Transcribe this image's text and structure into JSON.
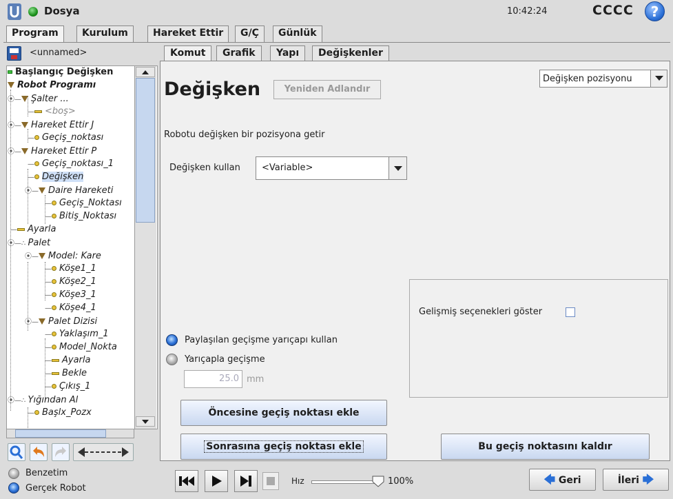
{
  "app": {
    "title": "Dosya",
    "clock": "10:42:24",
    "robot_name": "CCCC",
    "help": "?"
  },
  "main_tabs": [
    {
      "label": "Program"
    },
    {
      "label": "Kurulum"
    },
    {
      "label": "Hareket Ettir"
    },
    {
      "label": "G/Ç"
    },
    {
      "label": "Günlük"
    }
  ],
  "program": {
    "name": "<unnamed>"
  },
  "tree": [
    {
      "label": "Başlangıç Değişken",
      "icon": "green-bar-icon"
    },
    {
      "label": "Robot Programı",
      "icon": "triangle-icon"
    },
    {
      "label": "Şalter ...",
      "icon": "triangle-icon"
    },
    {
      "label": "<boş>",
      "icon": "bar-icon"
    },
    {
      "label": "Hareket Ettir J",
      "icon": "triangle-icon"
    },
    {
      "label": "Geçiş_noktası",
      "icon": "dot-icon"
    },
    {
      "label": "Hareket Ettir P",
      "icon": "triangle-icon"
    },
    {
      "label": "Geçiş_noktası_1",
      "icon": "dot-icon"
    },
    {
      "label": "Değişken",
      "icon": "dot-icon"
    },
    {
      "label": "Daire Hareketi",
      "icon": "triangle-icon"
    },
    {
      "label": "Geçiş_Noktası",
      "icon": "dot-icon"
    },
    {
      "label": "Bitiş_Noktası",
      "icon": "dot-icon"
    },
    {
      "label": "Ayarla",
      "icon": "bar-icon"
    },
    {
      "label": "Palet",
      "icon": "pallet-icon"
    },
    {
      "label": "Model: Kare",
      "icon": "triangle-icon"
    },
    {
      "label": "Köşe1_1",
      "icon": "dot-icon"
    },
    {
      "label": "Köşe2_1",
      "icon": "dot-icon"
    },
    {
      "label": "Köşe3_1",
      "icon": "dot-icon"
    },
    {
      "label": "Köşe4_1",
      "icon": "dot-icon"
    },
    {
      "label": "Palet Dizisi",
      "icon": "triangle-icon"
    },
    {
      "label": "Yaklaşım_1",
      "icon": "dot-icon"
    },
    {
      "label": "Model_Nokta",
      "icon": "dot-icon"
    },
    {
      "label": "Ayarla",
      "icon": "bar-icon"
    },
    {
      "label": "Bekle",
      "icon": "bar-icon"
    },
    {
      "label": "Çıkış_1",
      "icon": "dot-icon"
    },
    {
      "label": "Yığından Al",
      "icon": "pallet-icon"
    },
    {
      "label": "Başlx_Pozx",
      "icon": "dot-icon"
    }
  ],
  "sub_tabs": [
    {
      "label": "Komut"
    },
    {
      "label": "Grafik"
    },
    {
      "label": "Yapı"
    },
    {
      "label": "Değişkenler"
    }
  ],
  "command": {
    "heading": "Değişken",
    "rename_label": "Yeniden Adlandır",
    "position_type": "Değişken pozisyonu",
    "description": "Robotu değişken bir pozisyona getir",
    "variable_label": "Değişken kullan",
    "variable_value": "<Variable>",
    "advanced_label": "Gelişmiş seçenekleri göster",
    "radio_shared": "Paylaşılan geçişme yarıçapı kullan",
    "radio_radius": "Yarıçapla geçişme",
    "radius_value": "25.0",
    "radius_unit": "mm",
    "btn_before": "Öncesine geçiş noktası ekle",
    "btn_after": "Sonrasına geçiş noktası ekle",
    "btn_remove": "Bu geçiş noktasını kaldır"
  },
  "bottom": {
    "simulation": "Benzetim",
    "real_robot": "Gerçek Robot",
    "speed_label": "Hız",
    "speed_value": "100%",
    "speed_fraction": 1.0,
    "back": "Geri",
    "next": "İleri"
  }
}
